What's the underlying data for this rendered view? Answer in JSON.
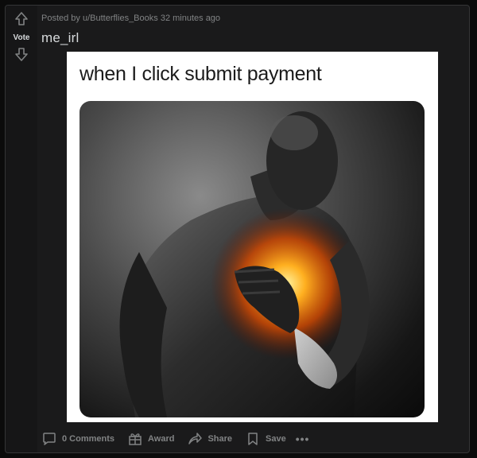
{
  "post": {
    "meta": {
      "prefix": "Posted by",
      "user": "u/Butterflies_Books",
      "time": "32 minutes ago"
    },
    "vote_label": "Vote",
    "title": "me_irl",
    "image": {
      "caption": "when I click submit payment"
    },
    "actions": {
      "comments": "0 Comments",
      "award": "Award",
      "share": "Share",
      "save": "Save",
      "more": "•••"
    }
  },
  "colors": {
    "background": "#0b0b0b",
    "card": "#1a1a1b",
    "text": "#d7dadc",
    "muted": "#818384"
  },
  "icons": [
    "upvote-arrow-icon",
    "downvote-arrow-icon",
    "comment-icon",
    "award-icon",
    "share-icon",
    "save-icon",
    "more-icon"
  ]
}
